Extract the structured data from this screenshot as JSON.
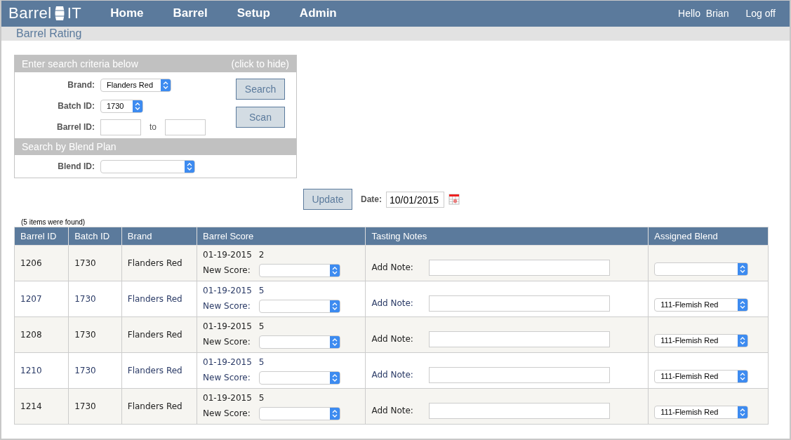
{
  "header": {
    "logo_left": "Barrel",
    "logo_right": "IT",
    "nav": [
      "Home",
      "Barrel",
      "Setup",
      "Admin"
    ],
    "greeting": "Hello  Brian",
    "logoff": "Log off"
  },
  "page_title": "Barrel Rating",
  "search_panel": {
    "title": "Enter search criteria below",
    "toggle": "(click to hide)",
    "brand": {
      "label": "Brand:",
      "value": "Flanders Red"
    },
    "batch": {
      "label": "Batch ID:",
      "value": "1730"
    },
    "barrel": {
      "label": "Barrel ID:",
      "to": "to"
    },
    "buttons": [
      "Search",
      "Scan"
    ],
    "blend_section": "Search by Blend Plan",
    "blend": {
      "label": "Blend ID:"
    }
  },
  "update_button": "Update",
  "date": {
    "label": "Date:",
    "value": "10/01/2015"
  },
  "result_count": "(5 items were found)",
  "table": {
    "columns": [
      "Barrel ID",
      "Batch ID",
      "Brand",
      "Barrel Score",
      "Tasting Notes",
      "Assigned Blend"
    ],
    "rows": [
      {
        "barrel_id": "1206",
        "batch_id": "1730",
        "brand": "Flanders Red",
        "score_date": "01-19-2015",
        "score": "2",
        "score_label": "New Score:",
        "note_label": "Add Note:"
      },
      {
        "barrel_id": "1207",
        "batch_id": "1730",
        "brand": "Flanders Red",
        "score_date": "01-19-2015",
        "score": "5",
        "score_label": "New Score:",
        "note_label": "Add Note:",
        "blend": "111-Flemish Red"
      },
      {
        "barrel_id": "1208",
        "batch_id": "1730",
        "brand": "Flanders Red",
        "score_date": "01-19-2015",
        "score": "5",
        "score_label": "New Score:",
        "note_label": "Add Note:",
        "blend": "111-Flemish Red"
      },
      {
        "barrel_id": "1210",
        "batch_id": "1730",
        "brand": "Flanders Red",
        "score_date": "01-19-2015",
        "score": "5",
        "score_label": "New Score:",
        "note_label": "Add Note:",
        "blend": "111-Flemish Red"
      },
      {
        "barrel_id": "1214",
        "batch_id": "1730",
        "brand": "Flanders Red",
        "score_date": "01-19-2015",
        "score": "5",
        "score_label": "New Score:",
        "note_label": "Add Note:",
        "blend": "111-Flemish Red"
      }
    ]
  }
}
